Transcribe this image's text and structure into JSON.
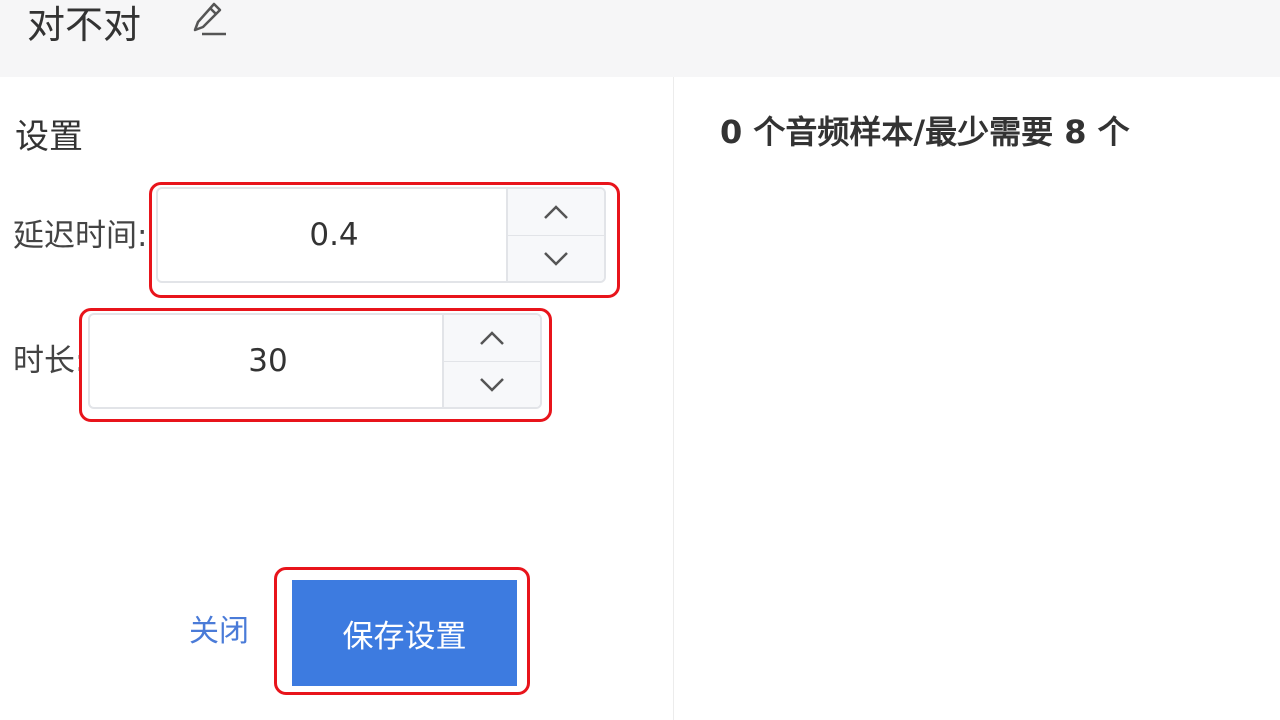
{
  "header": {
    "title": "对不对",
    "edit_icon": "pencil-icon"
  },
  "settings": {
    "heading": "设置",
    "delay": {
      "label": "延迟时间:",
      "value": "0.4"
    },
    "duration": {
      "label": "时长:",
      "value": "30"
    },
    "close_label": "关闭",
    "save_label": "保存设置"
  },
  "samples": {
    "status_text": "0 个音频样本/最少需要 8 个"
  },
  "colors": {
    "header_bg": "#f6f6f7",
    "primary": "#3d7be0",
    "highlight": "#e8141b",
    "link": "#4a7bd8"
  }
}
